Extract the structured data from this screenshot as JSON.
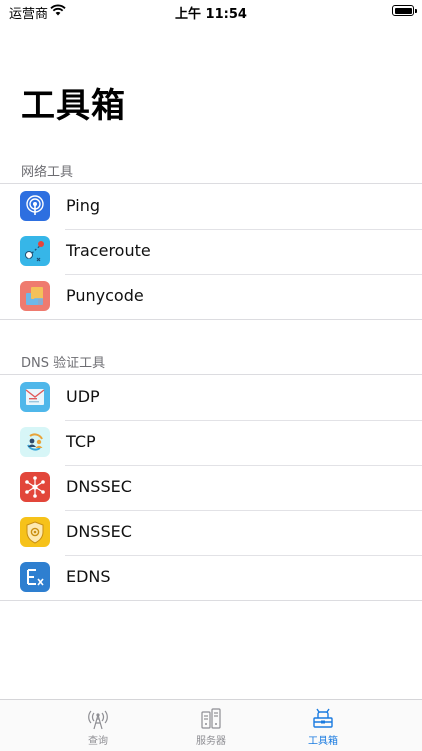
{
  "status_bar": {
    "carrier": "运营商",
    "time": "上午 11:54"
  },
  "page": {
    "title": "工具箱"
  },
  "sections": [
    {
      "header": "网络工具",
      "items": [
        {
          "label": "Ping",
          "icon": "ping-icon"
        },
        {
          "label": "Traceroute",
          "icon": "traceroute-map-icon"
        },
        {
          "label": "Punycode",
          "icon": "punycode-icon"
        }
      ]
    },
    {
      "header": "DNS 验证工具",
      "items": [
        {
          "label": "UDP",
          "icon": "udp-envelope-icon"
        },
        {
          "label": "TCP",
          "icon": "tcp-people-icon"
        },
        {
          "label": "DNSSEC",
          "icon": "dnssec-network-icon"
        },
        {
          "label": "DNSSEC",
          "icon": "dnssec-shield-icon"
        },
        {
          "label": "EDNS",
          "icon": "edns-ex-icon"
        }
      ]
    }
  ],
  "tab_bar": {
    "tabs": [
      {
        "label": "查询",
        "icon": "antenna-icon"
      },
      {
        "label": "服务器",
        "icon": "server-icon"
      },
      {
        "label": "工具箱",
        "icon": "toolbox-icon"
      }
    ],
    "active_color": "#1a7be0",
    "inactive_color": "#8e8e93"
  }
}
